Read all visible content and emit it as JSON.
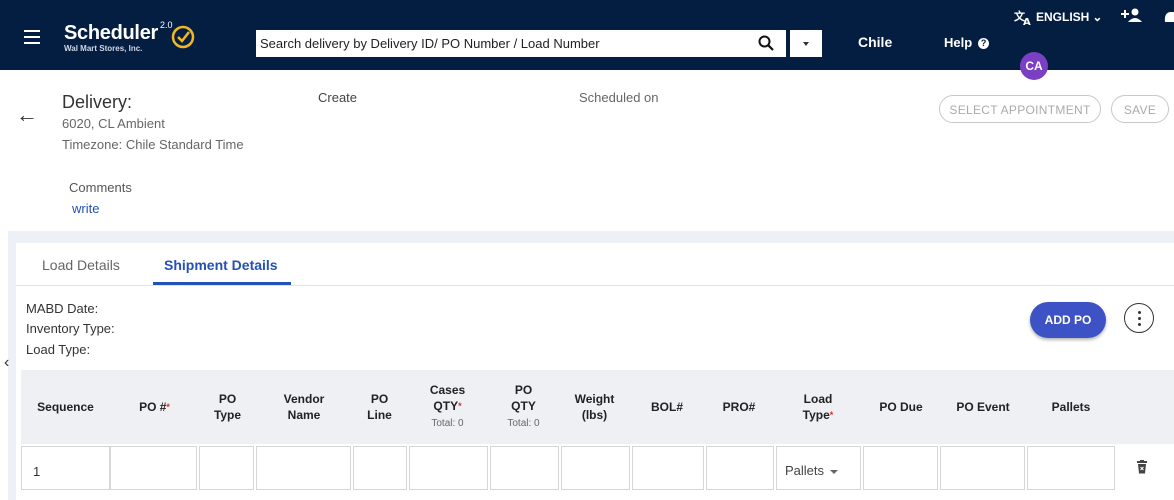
{
  "header": {
    "logo_title": "Scheduler",
    "logo_version": "2.0",
    "logo_subtitle": "Wal Mart Stores, Inc.",
    "search_placeholder": "Search delivery by Delivery ID/ PO Number / Load Number",
    "country": "Chile",
    "help_label": "Help",
    "language": "ENGLISH",
    "avatar_initials": "CA",
    "colors": {
      "bar": "#041e42",
      "avatar": "#7b3fc4"
    }
  },
  "delivery": {
    "title": "Delivery:",
    "location": "6020, CL Ambient",
    "timezone": "Timezone: Chile Standard Time",
    "create_label": "Create",
    "scheduled_label": "Scheduled on",
    "select_appointment_label": "SELECT APPOINTMENT",
    "save_label": "SAVE",
    "comments_label": "Comments",
    "write_link": "write"
  },
  "tabs": [
    {
      "label": "Load Details",
      "active": false
    },
    {
      "label": "Shipment Details",
      "active": true
    }
  ],
  "shipment": {
    "mabd_label": "MABD Date:",
    "inventory_label": "Inventory Type:",
    "load_type_label": "Load Type:",
    "add_po_label": "ADD PO"
  },
  "table": {
    "columns": [
      {
        "line1": "Sequence"
      },
      {
        "line1": "PO #",
        "required": "*"
      },
      {
        "line1": "PO",
        "line2": "Type"
      },
      {
        "line1": "Vendor",
        "line2": "Name"
      },
      {
        "line1": "PO",
        "line2": "Line"
      },
      {
        "line1": "Cases",
        "line2": "QTY",
        "required": "*",
        "total": "Total: 0"
      },
      {
        "line1": "PO",
        "line2": "QTY",
        "total": "Total: 0"
      },
      {
        "line1": "Weight",
        "line2": "(lbs)"
      },
      {
        "line1": "BOL#"
      },
      {
        "line1": "PRO#"
      },
      {
        "line1": "Load",
        "line2": "Type",
        "required": "*"
      },
      {
        "line1": "PO Due"
      },
      {
        "line1": "PO Event"
      },
      {
        "line1": "Pallets"
      }
    ],
    "rows": [
      {
        "sequence": "1",
        "load_type": "Pallets"
      }
    ]
  }
}
